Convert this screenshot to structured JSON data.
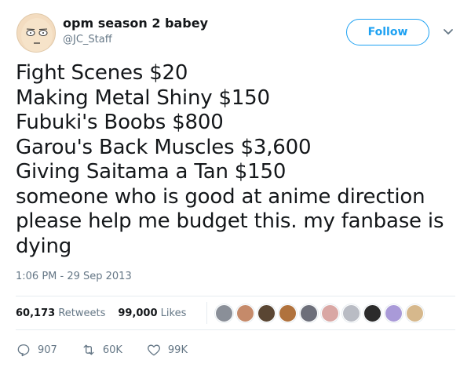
{
  "user": {
    "display_name": "opm season 2 babey",
    "handle": "@JC_Staff"
  },
  "follow_button": {
    "label": "Follow"
  },
  "tweet": {
    "lines": [
      "Fight Scenes $20",
      "Making Metal Shiny $150",
      "Fubuki's Boobs $800",
      "Garou's Back Muscles $3,600",
      "Giving Saitama a Tan $150",
      "someone who is good at anime direction",
      "please help me budget this. my fanbase is",
      "dying"
    ],
    "timestamp": "1:06 PM - 29 Sep 2013"
  },
  "stats": {
    "retweets_count": "60,173",
    "retweets_label": "Retweets",
    "likes_count": "99,000",
    "likes_label": "Likes",
    "liker_avatars": [
      "#8a8f98",
      "#c58a6a",
      "#5a4633",
      "#b0723d",
      "#6d6f7a",
      "#d9a7a4",
      "#b9bcc4",
      "#2b2b2b",
      "#a99ad8",
      "#d6b88c"
    ]
  },
  "actions": {
    "reply_count": "907",
    "retweet_count": "60K",
    "like_count": "99K"
  },
  "colors": {
    "accent": "#1da1f2",
    "muted": "#657786"
  }
}
